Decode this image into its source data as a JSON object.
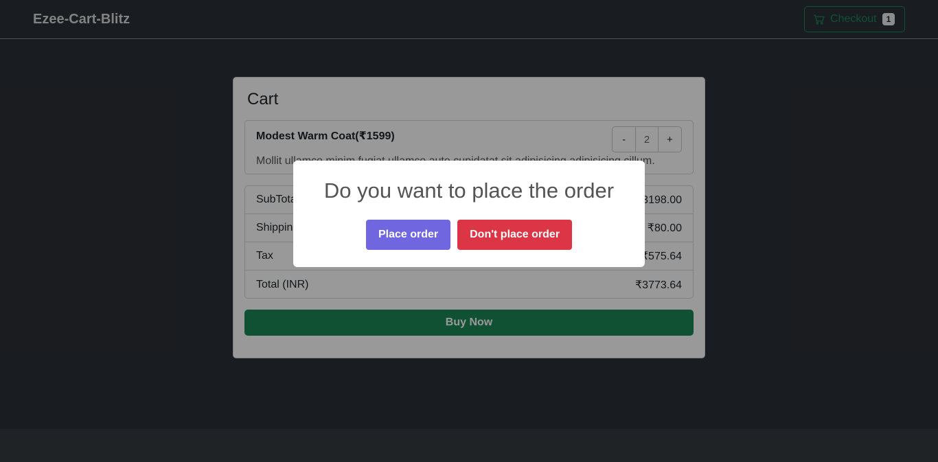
{
  "navbar": {
    "brand": "Ezee-Cart-Blitz",
    "checkout_label": "Checkout",
    "cart_count": "1",
    "cart_icon": "cart-icon"
  },
  "cart": {
    "title": "Cart",
    "items": [
      {
        "name": "Modest Warm Coat(₹1599)",
        "description": "Mollit ullamco minim fugiat ullamco aute cupidatat sit adipisicing adipisicing cillum.",
        "decrement_label": "-",
        "quantity": "2",
        "increment_label": "+"
      }
    ],
    "summary": [
      {
        "label": "SubTotal",
        "value": "₹3198.00"
      },
      {
        "label": "Shipping",
        "value": "₹80.00"
      },
      {
        "label": "Tax",
        "value": "₹575.64"
      },
      {
        "label": "Total (INR)",
        "value": "₹3773.64"
      }
    ],
    "buy_label": "Buy Now"
  },
  "modal": {
    "title": "Do you want to place the order",
    "confirm_label": "Place order",
    "deny_label": "Don't place order"
  },
  "colors": {
    "success": "#198754",
    "confirm": "#7066e0",
    "deny": "#dc3545",
    "background": "#212529"
  }
}
